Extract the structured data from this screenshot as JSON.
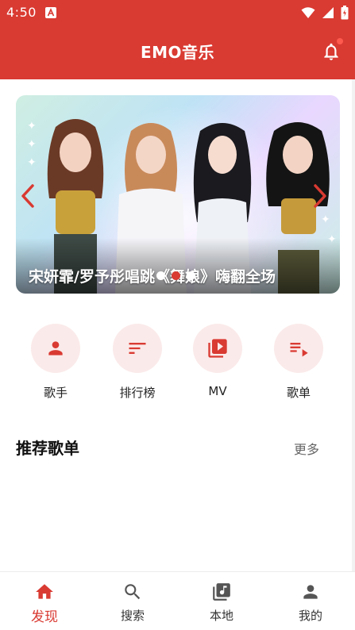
{
  "status_bar": {
    "time": "4:50"
  },
  "header": {
    "title": "EMO音乐",
    "bell_icon": "bell-icon",
    "has_notification_dot": true
  },
  "banner": {
    "caption": "宋妍霏/罗予彤唱跳《舞娘》嗨翻全场",
    "slide_count": 3,
    "active_slide": 2
  },
  "quick_entries": [
    {
      "label": "歌手",
      "icon": "person-icon"
    },
    {
      "label": "排行榜",
      "icon": "sort-icon"
    },
    {
      "label": "MV",
      "icon": "video-library-icon"
    },
    {
      "label": "歌单",
      "icon": "playlist-icon"
    }
  ],
  "recommended": {
    "title": "推荐歌单",
    "more_label": "更多"
  },
  "bottom_nav": [
    {
      "label": "发现",
      "icon": "home-icon",
      "active": true
    },
    {
      "label": "搜索",
      "icon": "search-icon",
      "active": false
    },
    {
      "label": "本地",
      "icon": "music-library-icon",
      "active": false
    },
    {
      "label": "我的",
      "icon": "person-icon",
      "active": false
    }
  ],
  "colors": {
    "primary": "#d93a32",
    "quick_circle_bg": "#fbeaea"
  }
}
